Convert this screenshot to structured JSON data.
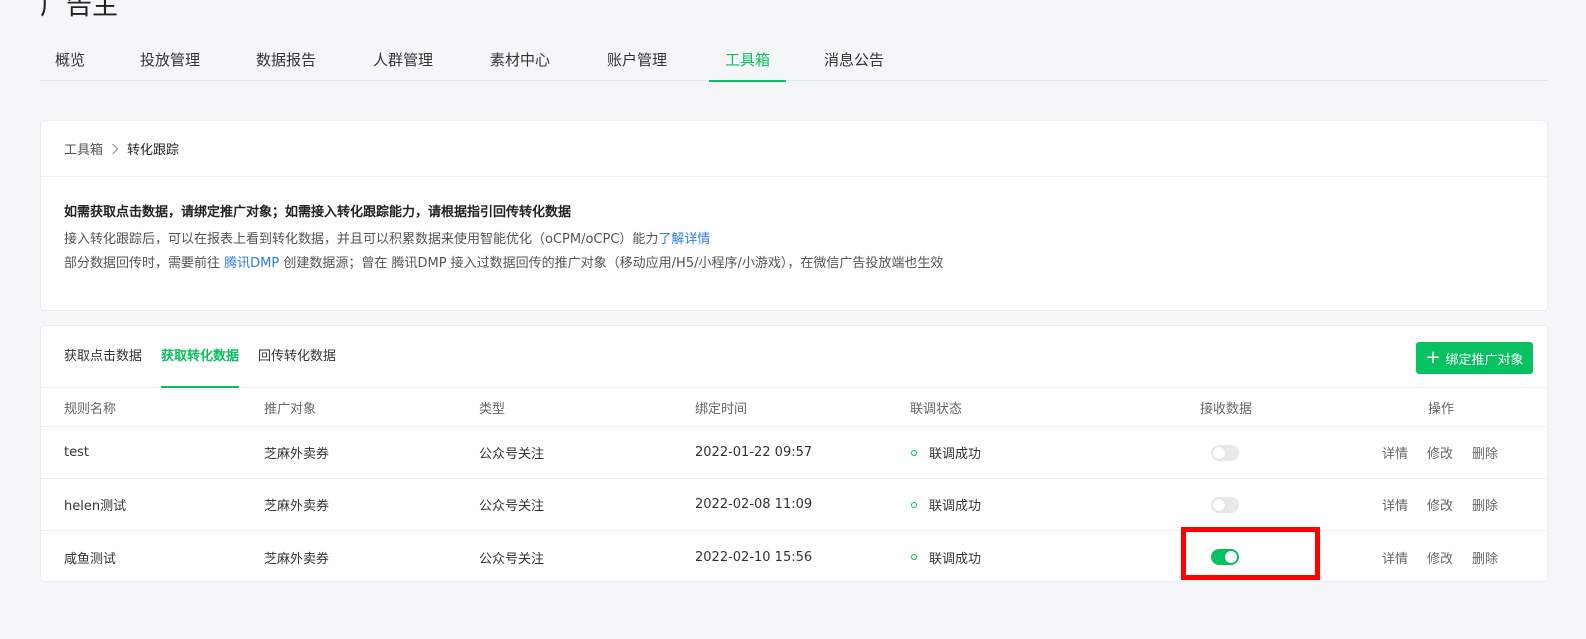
{
  "app": {
    "title": "广告主"
  },
  "topnav": {
    "items": [
      {
        "label": "概览"
      },
      {
        "label": "投放管理"
      },
      {
        "label": "数据报告"
      },
      {
        "label": "人群管理"
      },
      {
        "label": "素材中心"
      },
      {
        "label": "账户管理"
      },
      {
        "label": "工具箱"
      },
      {
        "label": "消息公告"
      }
    ],
    "active": "工具箱"
  },
  "breadcrumb": {
    "root": "工具箱",
    "current": "转化跟踪"
  },
  "notice": {
    "title": "如需获取点击数据，请绑定推广对象；如需接入转化跟踪能力，请根据指引回传转化数据",
    "line1_text": "接入转化跟踪后，可以在报表上看到转化数据，并且可以积累数据来使用智能优化（oCPM/oCPC）能力",
    "line1_link": "了解详情",
    "line2_prefix": "部分数据回传时，需要前往 ",
    "line2_link": "腾讯DMP",
    "line2_suffix": " 创建数据源；曾在 腾讯DMP 接入过数据回传的推广对象（移动应用/H5/小程序/小游戏），在微信广告投放端也生效"
  },
  "tabs": {
    "items": [
      {
        "label": "获取点击数据"
      },
      {
        "label": "获取转化数据"
      },
      {
        "label": "回传转化数据"
      }
    ],
    "active": "获取转化数据",
    "bind_button": "绑定推广对象"
  },
  "table": {
    "headers": {
      "name": "规则名称",
      "target": "推广对象",
      "type": "类型",
      "time": "绑定时间",
      "status": "联调状态",
      "receive": "接收数据",
      "ops": "操作"
    },
    "rows": [
      {
        "name": "test",
        "target": "芝麻外卖券",
        "type": "公众号关注",
        "time": "2022-01-22 09:57",
        "status": "联调成功",
        "receive": "off"
      },
      {
        "name": "helen测试",
        "target": "芝麻外卖券",
        "type": "公众号关注",
        "time": "2022-02-08 11:09",
        "status": "联调成功",
        "receive": "off"
      },
      {
        "name": "咸鱼测试",
        "target": "芝麻外卖券",
        "type": "公众号关注",
        "time": "2022-02-10 15:56",
        "status": "联调成功",
        "receive": "on"
      }
    ],
    "ops": {
      "detail": "详情",
      "edit": "修改",
      "delete": "删除"
    }
  },
  "colors": {
    "accent": "#07c160",
    "link": "#2b7fe0",
    "highlight": "#ff0000"
  }
}
